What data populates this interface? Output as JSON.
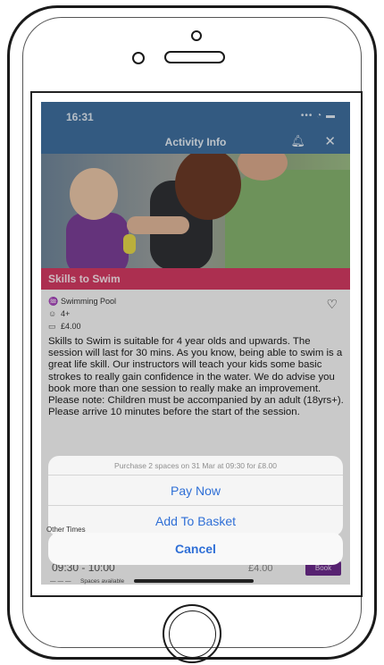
{
  "status_bar": {
    "time": "16:31",
    "icons": "••• ◔ ▬"
  },
  "header": {
    "title": "Activity Info"
  },
  "activity": {
    "title": "Skills to Swim",
    "venue": "Swimming Pool",
    "age": "4+",
    "price": "£4.00",
    "description": "Skills to Swim is suitable for 4 year olds and upwards. The session will last for 30 mins. As you know, being able to swim is a great life skill. Our instructors will teach your kids some basic strokes to really gain confidence in the water. We do advise you book more than one session to really make an improvement. Please note: Children must be accompanied by an adult (18yrs+). Please arrive 10 minutes before the start of the session."
  },
  "action_sheet": {
    "message": "Purchase 2  spaces on 31 Mar at 09:30 for £8.00",
    "pay_now": "Pay Now",
    "add_to_basket": "Add To Basket",
    "cancel": "Cancel"
  },
  "other_times": {
    "label": "Other Times",
    "slot_time": "09:30 - 10:00",
    "slot_price": "£4.00",
    "book_label": "Book",
    "spaces_label": "Spaces available"
  },
  "colors": {
    "header": "#3f6e9e",
    "title_bar": "#d23a62",
    "action_text": "#2f6fd6",
    "book_button": "#6b2a8a"
  },
  "icons": {
    "bell": "bell-icon",
    "close": "close-icon",
    "venue": "pool-icon",
    "age": "person-icon",
    "price": "ticket-icon",
    "favourite": "heart-icon"
  }
}
